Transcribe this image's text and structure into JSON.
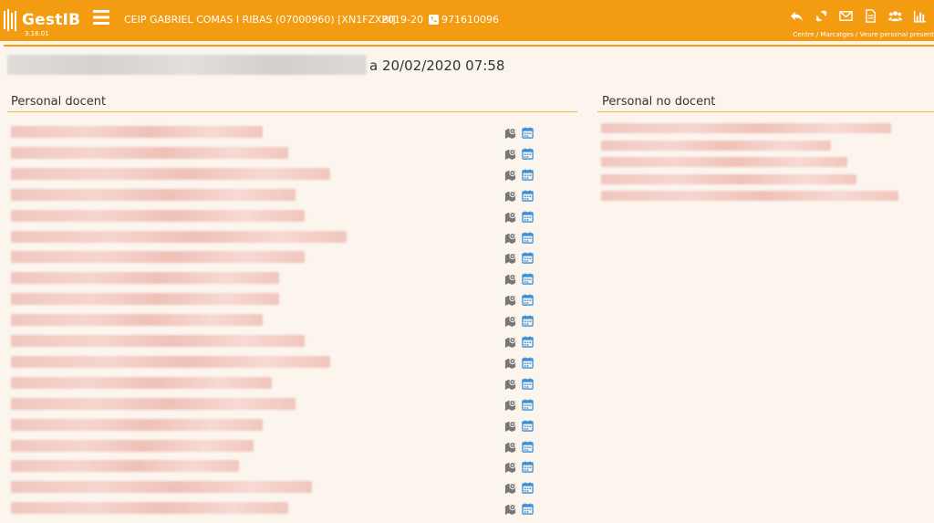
{
  "app": {
    "name": "GestIB",
    "version": "3.16.01"
  },
  "header": {
    "school": "CEIP GABRIEL COMAS I RIBAS (07000960) [XN1FZXBI]",
    "year": "2019-20",
    "phone": "971610096",
    "breadcrumb": "Centre / Marcatges / Veure personal present"
  },
  "page": {
    "date_text": "a 20/02/2020 07:58"
  },
  "teaching": {
    "title": "Personal docent",
    "rows": [
      {
        "width": 276
      },
      {
        "width": 304
      },
      {
        "width": 350
      },
      {
        "width": 312
      },
      {
        "width": 322
      },
      {
        "width": 368
      },
      {
        "width": 322
      },
      {
        "width": 294
      },
      {
        "width": 294
      },
      {
        "width": 276
      },
      {
        "width": 322
      },
      {
        "width": 350
      },
      {
        "width": 286
      },
      {
        "width": 312
      },
      {
        "width": 276
      },
      {
        "width": 266
      },
      {
        "width": 250
      },
      {
        "width": 330
      },
      {
        "width": 304
      },
      {
        "width": 368
      }
    ]
  },
  "non_teaching": {
    "title": "Personal no docent",
    "rows": [
      {
        "width": 318
      },
      {
        "width": 252
      },
      {
        "width": 270
      },
      {
        "width": 280
      },
      {
        "width": 326
      }
    ]
  },
  "colors": {
    "accent": "#f39c12",
    "blur": "#f0c7bf",
    "icon_gray": "#777777",
    "icon_blue": "#3a8fd6"
  }
}
